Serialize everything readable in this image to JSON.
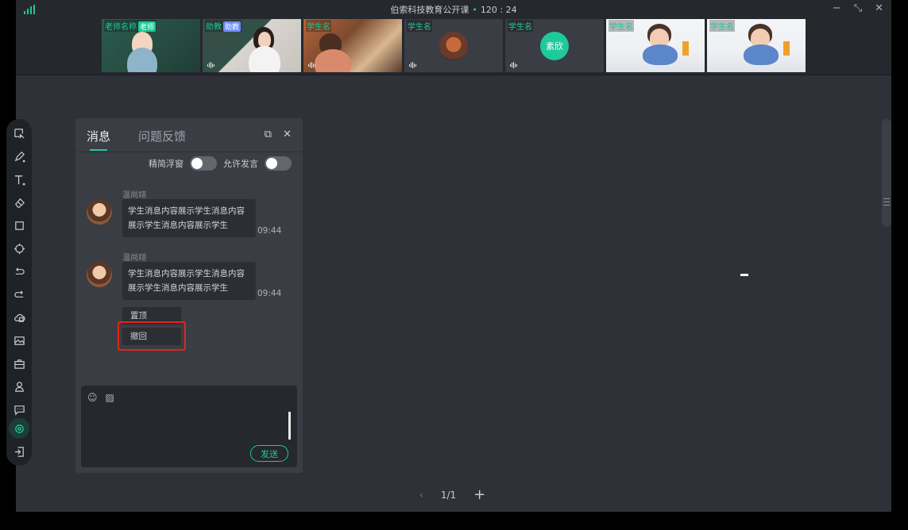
{
  "window": {
    "title": "伯索科技教育公开课",
    "timer": "120 : 24",
    "controls": [
      "minimize-icon",
      "shrink-icon",
      "close-icon"
    ]
  },
  "videos": [
    {
      "name": "老师名称",
      "role": "老师",
      "scene": "teacher"
    },
    {
      "name": "助教",
      "role": "助教",
      "scene": "assistant"
    },
    {
      "name": "学生名",
      "scene": "kid-drawing"
    },
    {
      "name": "学生名",
      "scene": "avatar"
    },
    {
      "name": "学生名",
      "avatar_text": "素欣",
      "scene": "initials"
    },
    {
      "name": "学生名",
      "scene": "boy"
    },
    {
      "name": "学生名",
      "scene": "boy"
    }
  ],
  "toolbar": {
    "tools": [
      "select-icon",
      "pen-icon",
      "text-icon",
      "eraser-icon",
      "shape-icon",
      "laser-icon",
      "undo-icon",
      "redo-icon",
      "cloud-icon",
      "image-icon",
      "toolbox-icon",
      "user-icon",
      "chat-icon",
      "settings-icon",
      "exit-icon"
    ],
    "active": "settings-icon"
  },
  "panel": {
    "tab_messages": "消息",
    "tab_feedback": "问题反馈",
    "switch_float": "精简浮窗",
    "switch_allow": "允许发言",
    "messages": [
      {
        "sender": "温尚翊",
        "text": "学生消息内容展示学生消息内容展示学生消息内容展示学生",
        "time": "09:44"
      },
      {
        "sender": "温尚翊",
        "text": "学生消息内容展示学生消息内容展示学生消息内容展示学生",
        "time": "09:44"
      }
    ],
    "context_menu": [
      "置顶",
      "撤回"
    ],
    "highlighted_menu_item": "撤回",
    "send_label": "发送"
  },
  "pager": {
    "current": "1/1"
  },
  "colors": {
    "accent": "#1ec99a",
    "background": "#2e3138",
    "panel": "#3a3d44",
    "highlight": "#e1251b"
  }
}
